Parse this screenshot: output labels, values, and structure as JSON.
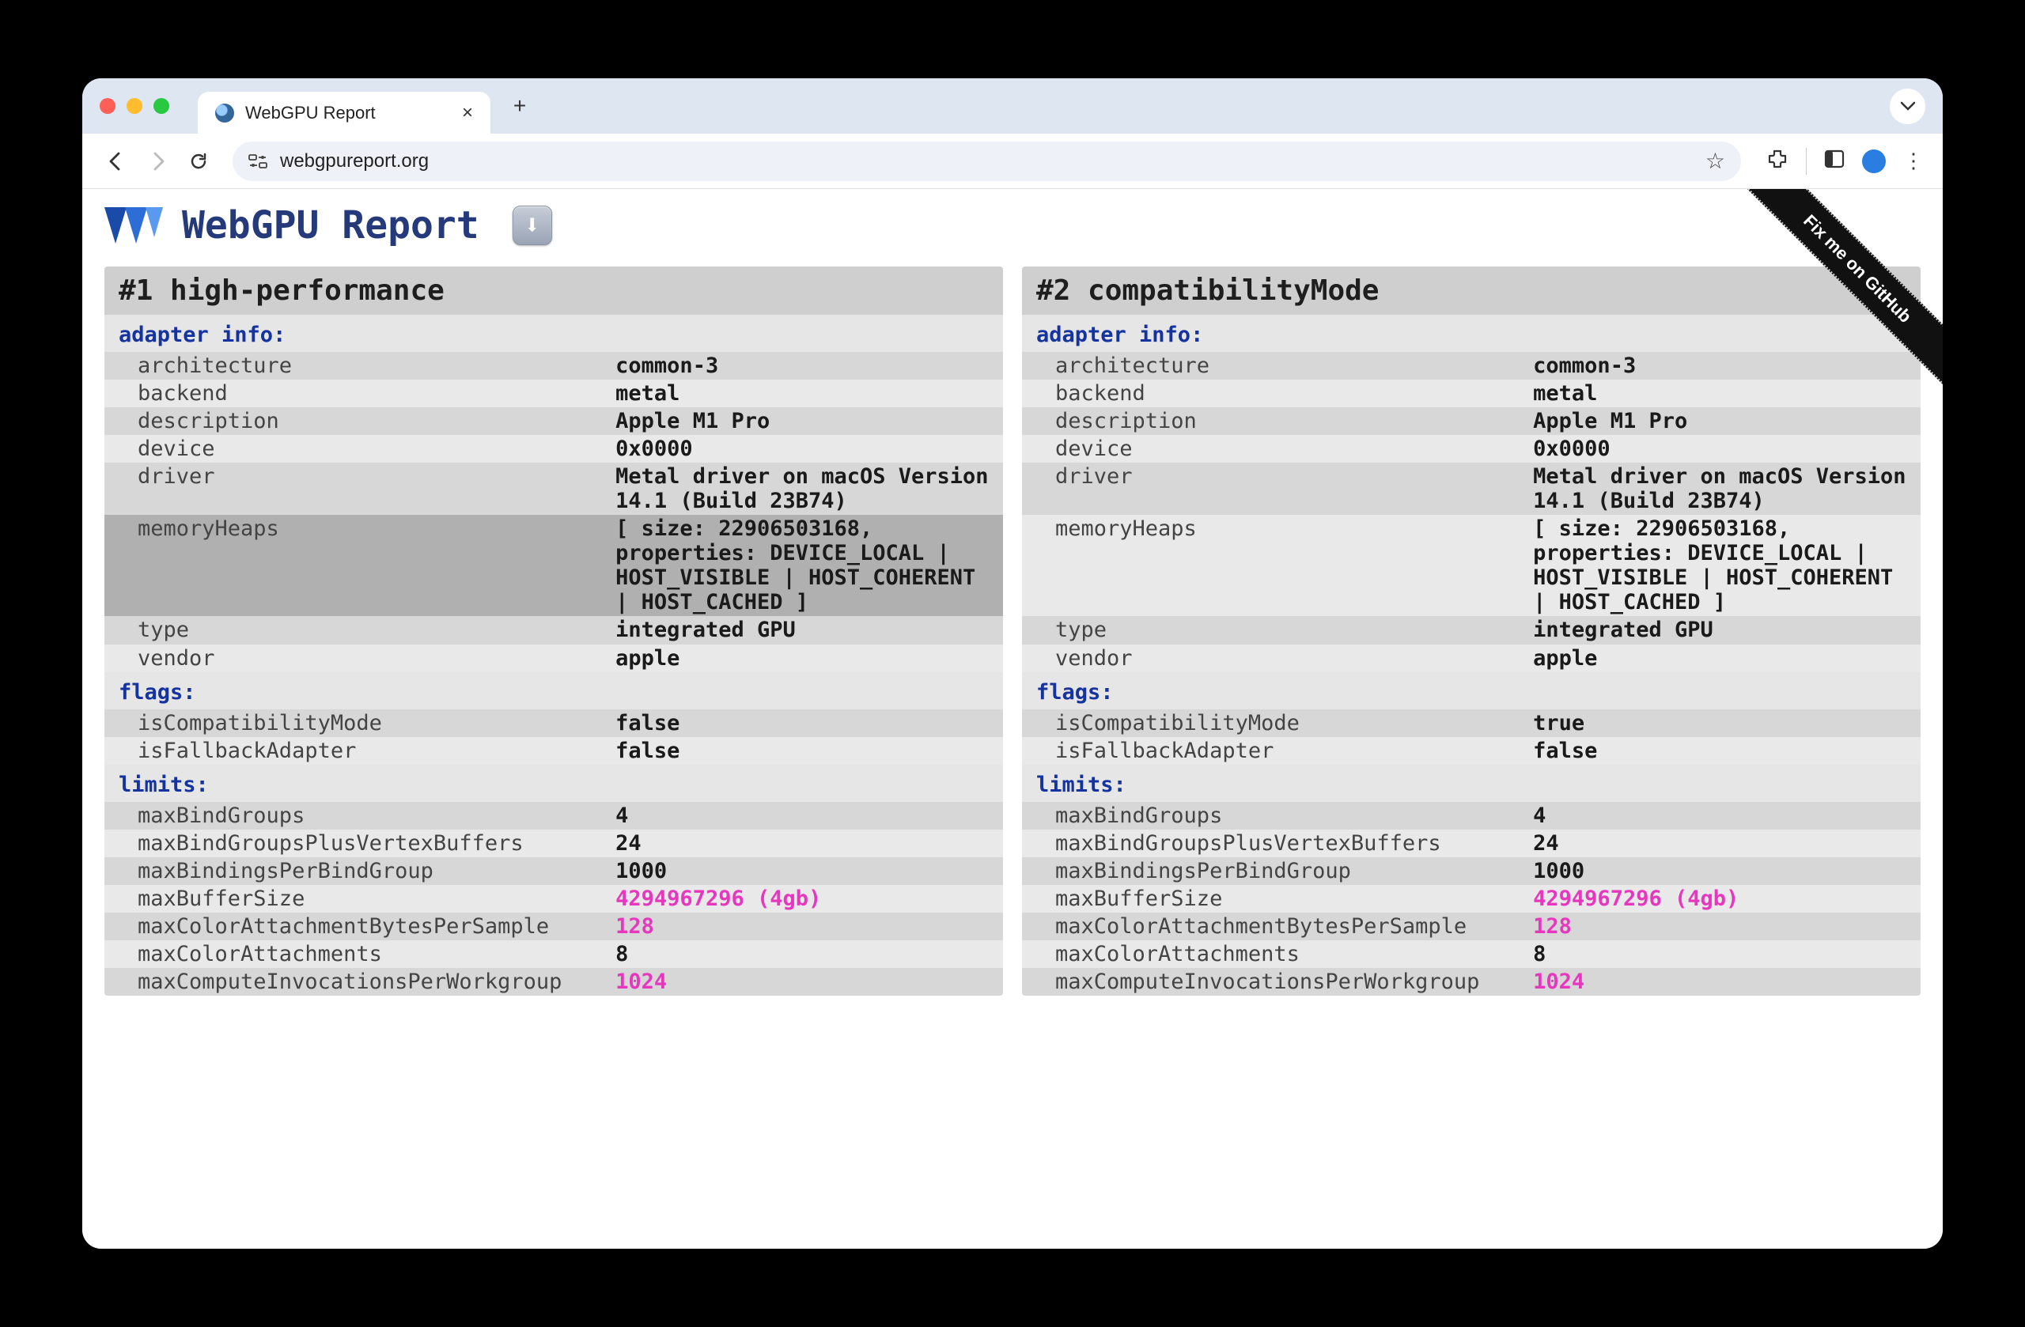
{
  "browser": {
    "tab_title": "WebGPU Report",
    "url": "webgpureport.org",
    "ribbon": "Fix me on GitHub"
  },
  "header": {
    "title": "WebGPU Report",
    "download_glyph": "⬇"
  },
  "panels": [
    {
      "title": "#1 high-performance",
      "sections": {
        "adapter_info_label": "adapter info:",
        "adapter_info": [
          {
            "k": "architecture",
            "v": "common-3"
          },
          {
            "k": "backend",
            "v": "metal"
          },
          {
            "k": "description",
            "v": "Apple M1 Pro"
          },
          {
            "k": "device",
            "v": "0x0000"
          },
          {
            "k": "driver",
            "v": "Metal driver on macOS Version 14.1 (Build 23B74)"
          },
          {
            "k": "memoryHeaps",
            "v": "[ size: 22906503168, properties: DEVICE_LOCAL | HOST_VISIBLE | HOST_COHERENT | HOST_CACHED ]",
            "hi": true
          },
          {
            "k": "type",
            "v": "integrated GPU"
          },
          {
            "k": "vendor",
            "v": "apple"
          }
        ],
        "flags_label": "flags:",
        "flags": [
          {
            "k": "isCompatibilityMode",
            "v": "false"
          },
          {
            "k": "isFallbackAdapter",
            "v": "false"
          }
        ],
        "limits_label": "limits:",
        "limits": [
          {
            "k": "maxBindGroups",
            "v": "4"
          },
          {
            "k": "maxBindGroupsPlusVertexBuffers",
            "v": "24"
          },
          {
            "k": "maxBindingsPerBindGroup",
            "v": "1000"
          },
          {
            "k": "maxBufferSize",
            "v": "4294967296 (4gb)",
            "pink": true
          },
          {
            "k": "maxColorAttachmentBytesPerSample",
            "v": "128",
            "pink": true
          },
          {
            "k": "maxColorAttachments",
            "v": "8"
          },
          {
            "k": "maxComputeInvocationsPerWorkgroup",
            "v": "1024",
            "pink": true
          }
        ]
      }
    },
    {
      "title": "#2 compatibilityMode",
      "sections": {
        "adapter_info_label": "adapter info:",
        "adapter_info": [
          {
            "k": "architecture",
            "v": "common-3"
          },
          {
            "k": "backend",
            "v": "metal"
          },
          {
            "k": "description",
            "v": "Apple M1 Pro"
          },
          {
            "k": "device",
            "v": "0x0000"
          },
          {
            "k": "driver",
            "v": "Metal driver on macOS Version 14.1 (Build 23B74)"
          },
          {
            "k": "memoryHeaps",
            "v": "[ size: 22906503168, properties: DEVICE_LOCAL | HOST_VISIBLE | HOST_COHERENT | HOST_CACHED ]"
          },
          {
            "k": "type",
            "v": "integrated GPU"
          },
          {
            "k": "vendor",
            "v": "apple"
          }
        ],
        "flags_label": "flags:",
        "flags": [
          {
            "k": "isCompatibilityMode",
            "v": "true"
          },
          {
            "k": "isFallbackAdapter",
            "v": "false"
          }
        ],
        "limits_label": "limits:",
        "limits": [
          {
            "k": "maxBindGroups",
            "v": "4"
          },
          {
            "k": "maxBindGroupsPlusVertexBuffers",
            "v": "24"
          },
          {
            "k": "maxBindingsPerBindGroup",
            "v": "1000"
          },
          {
            "k": "maxBufferSize",
            "v": "4294967296 (4gb)",
            "pink": true
          },
          {
            "k": "maxColorAttachmentBytesPerSample",
            "v": "128",
            "pink": true
          },
          {
            "k": "maxColorAttachments",
            "v": "8"
          },
          {
            "k": "maxComputeInvocationsPerWorkgroup",
            "v": "1024",
            "pink": true
          }
        ]
      }
    }
  ]
}
